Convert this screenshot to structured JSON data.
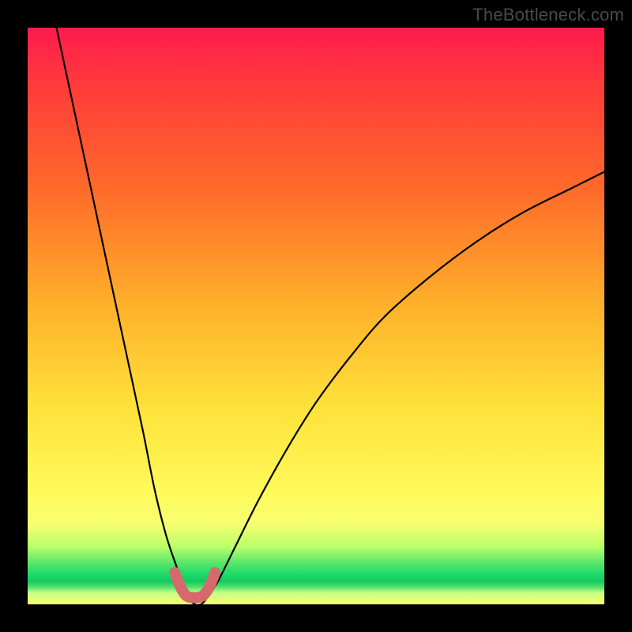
{
  "watermark": "TheBottleneck.com",
  "chart_data": {
    "type": "line",
    "title": "",
    "xlabel": "",
    "ylabel": "",
    "xlim": [
      0,
      100
    ],
    "ylim": [
      0,
      100
    ],
    "series": [
      {
        "name": "bottleneck-curve",
        "x": [
          5,
          8,
          11,
          14,
          17,
          20,
          22,
          24,
          26,
          27,
          28,
          29,
          30,
          31,
          33,
          36,
          40,
          45,
          50,
          56,
          62,
          70,
          78,
          86,
          94,
          100
        ],
        "values": [
          100,
          86,
          72,
          58,
          44,
          30,
          20,
          12,
          6,
          3,
          1,
          0,
          0,
          1,
          4,
          10,
          18,
          27,
          35,
          43,
          50,
          57,
          63,
          68,
          72,
          75
        ]
      },
      {
        "name": "highlight-bottom-u",
        "x": [
          25.5,
          26.5,
          27.5,
          28.5,
          29.5,
          30.5,
          31.5,
          32.5
        ],
        "values": [
          5.5,
          3.0,
          1.5,
          1.2,
          1.2,
          1.6,
          3.0,
          5.5
        ]
      }
    ],
    "colors": {
      "curve": "#000000",
      "highlight": "#d66a6a",
      "background_top": "#ff1a4d",
      "background_mid": "#ffe23a",
      "background_bottom": "#19d867"
    }
  }
}
